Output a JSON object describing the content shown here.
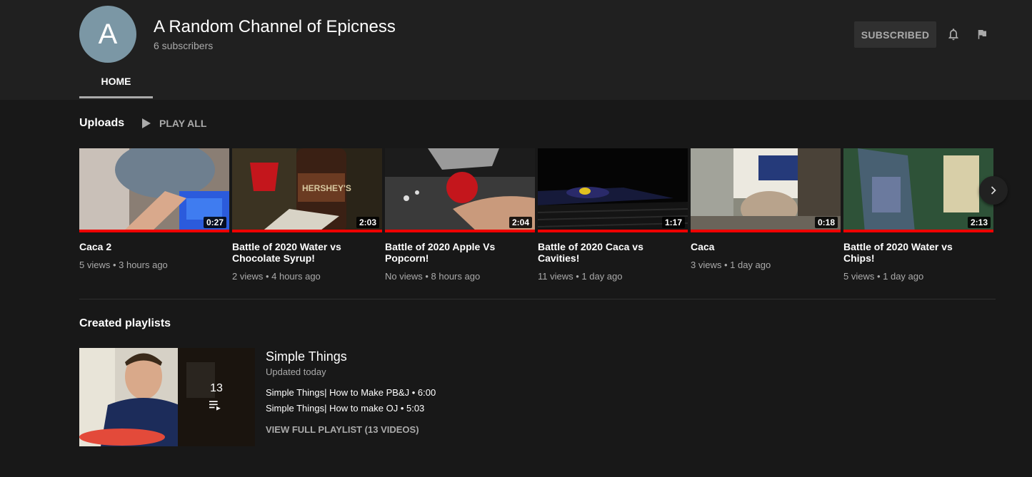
{
  "channel": {
    "avatar_letter": "A",
    "name": "A Random Channel of Epicness",
    "subscribers": "6 subscribers",
    "subscribe_label": "SUBSCRIBED"
  },
  "tabs": [
    {
      "label": "HOME"
    }
  ],
  "uploads": {
    "title": "Uploads",
    "play_all": "PLAY ALL",
    "videos": [
      {
        "title": "Caca 2",
        "meta": "5 views • 3 hours ago",
        "duration": "0:27"
      },
      {
        "title": "Battle of 2020 Water vs Chocolate Syrup!",
        "meta": "2 views • 4 hours ago",
        "duration": "2:03"
      },
      {
        "title": "Battle of 2020 Apple Vs Popcorn!",
        "meta": "No views • 8 hours ago",
        "duration": "2:04"
      },
      {
        "title": "Battle of 2020 Caca vs Cavities!",
        "meta": "11 views • 1 day ago",
        "duration": "1:17"
      },
      {
        "title": "Caca",
        "meta": "3 views • 1 day ago",
        "duration": "0:18"
      },
      {
        "title": "Battle of 2020 Water vs Chips!",
        "meta": "5 views • 1 day ago",
        "duration": "2:13"
      }
    ]
  },
  "playlists": {
    "title": "Created playlists",
    "items": [
      {
        "name": "Simple Things",
        "updated": "Updated today",
        "count": "13",
        "entries": [
          "Simple Things| How to Make PB&J • 6:00",
          "Simple Things| How to make OJ • 5:03"
        ],
        "view_label": "VIEW FULL PLAYLIST (13 VIDEOS)"
      }
    ]
  },
  "icons": {
    "bell": "bell-icon",
    "flag": "flag-icon",
    "play": "play-icon",
    "next": "chevron-right-icon",
    "playlist": "playlist-icon"
  },
  "colors": {
    "background": "#181818",
    "header": "#202020",
    "progress": "#ee0000",
    "avatar": "#7b97a5"
  }
}
